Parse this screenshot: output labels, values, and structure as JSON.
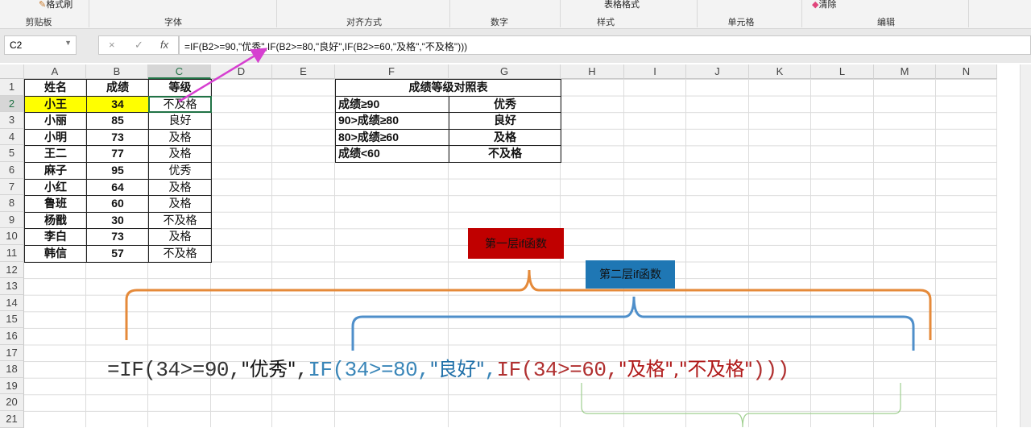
{
  "ribbon": {
    "top_items": {
      "format_painter": "格式刷",
      "table_format": "表格格式",
      "clear": "清除"
    },
    "groups": [
      "剪贴板",
      "字体",
      "对齐方式",
      "数字",
      "样式",
      "单元格",
      "编辑"
    ]
  },
  "formula_bar": {
    "name_box": "C2",
    "cancel": "×",
    "enter": "✓",
    "fx": "fx",
    "formula": "=IF(B2>=90,\"优秀\",IF(B2>=80,\"良好\",IF(B2>=60,\"及格\",\"不及格\")))"
  },
  "columns": [
    "A",
    "B",
    "C",
    "D",
    "E",
    "F",
    "G",
    "H",
    "I",
    "J",
    "K",
    "L",
    "M",
    "N"
  ],
  "rows": [
    "1",
    "2",
    "3",
    "4",
    "5",
    "6",
    "7",
    "8",
    "9",
    "10",
    "11",
    "12",
    "13",
    "14",
    "15",
    "16",
    "17",
    "18",
    "19",
    "20",
    "21"
  ],
  "table": {
    "headers": [
      "姓名",
      "成绩",
      "等级"
    ],
    "rows": [
      [
        "小王",
        "34",
        "不及格"
      ],
      [
        "小丽",
        "85",
        "良好"
      ],
      [
        "小明",
        "73",
        "及格"
      ],
      [
        "王二",
        "77",
        "及格"
      ],
      [
        "麻子",
        "95",
        "优秀"
      ],
      [
        "小红",
        "64",
        "及格"
      ],
      [
        "鲁班",
        "60",
        "及格"
      ],
      [
        "杨戬",
        "30",
        "不及格"
      ],
      [
        "李白",
        "73",
        "及格"
      ],
      [
        "韩信",
        "57",
        "不及格"
      ]
    ]
  },
  "lookup": {
    "title": "成绩等级对照表",
    "rows": [
      [
        "成绩≥90",
        "优秀"
      ],
      [
        "90>成绩≥80",
        "良好"
      ],
      [
        "80>成绩≥60",
        "及格"
      ],
      [
        "成绩<60",
        "不及格"
      ]
    ]
  },
  "annotations": {
    "layer1": "第一层if函数",
    "layer2": "第二层if函数",
    "layer1_color": "#c00000",
    "layer2_color": "#1f77b4",
    "f1": "=IF(34>=90,",
    "f1cn": "\"优秀\"",
    "f1b": ",",
    "f2": "IF(34>=80,",
    "f2cn": "\"良好\"",
    "f2b": ",",
    "f3": "IF(34>=60,",
    "f3cn": "\"及格\",\"不及格\"",
    "f3b": ")))"
  }
}
